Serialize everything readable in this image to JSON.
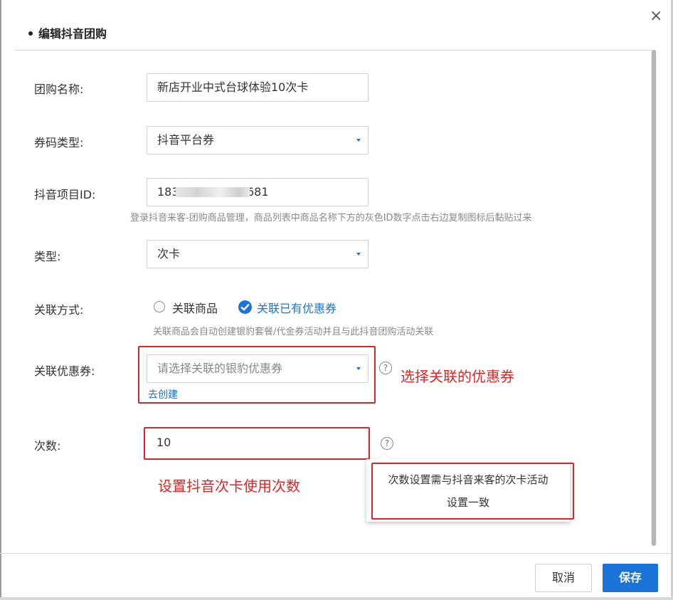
{
  "dialog": {
    "title": "编辑抖音团购",
    "close_label": "×"
  },
  "form": {
    "name": {
      "label": "团购名称:",
      "value": "新店开业中式台球体验10次卡"
    },
    "code_type": {
      "label": "券码类型:",
      "value": "抖音平台券"
    },
    "project_id": {
      "label": "抖音项目ID:",
      "value_prefix": "183",
      "value_suffix": "681",
      "hint": "登录抖音来客-团购商品管理，商品列表中商品名称下方的灰色ID数字点击右边复制图标后黏贴过来"
    },
    "type": {
      "label": "类型:",
      "value": "次卡"
    },
    "relation": {
      "label": "关联方式:",
      "options": [
        "关联商品",
        "关联已有优惠券"
      ],
      "selected": "关联已有优惠券",
      "hint": "关联商品会自动创建银豹套餐/代金券活动并且与此抖音团购活动关联"
    },
    "coupon": {
      "label": "关联优惠券:",
      "placeholder": "请选择关联的银豹优惠券",
      "create_link": "去创建",
      "help_icon": "?"
    },
    "count": {
      "label": "次数:",
      "value": "10",
      "help_icon": "?",
      "tooltip_line1": "次数设置需与抖音来客的次卡活动",
      "tooltip_line2": "设置一致"
    }
  },
  "annotations": {
    "coupon_note": "选择关联的优惠券",
    "count_note": "设置抖音次卡使用次数"
  },
  "footer": {
    "cancel_label": "取消",
    "save_label": "保存"
  },
  "colors": {
    "primary": "#1a73d9",
    "annotation_red": "#e02424"
  }
}
